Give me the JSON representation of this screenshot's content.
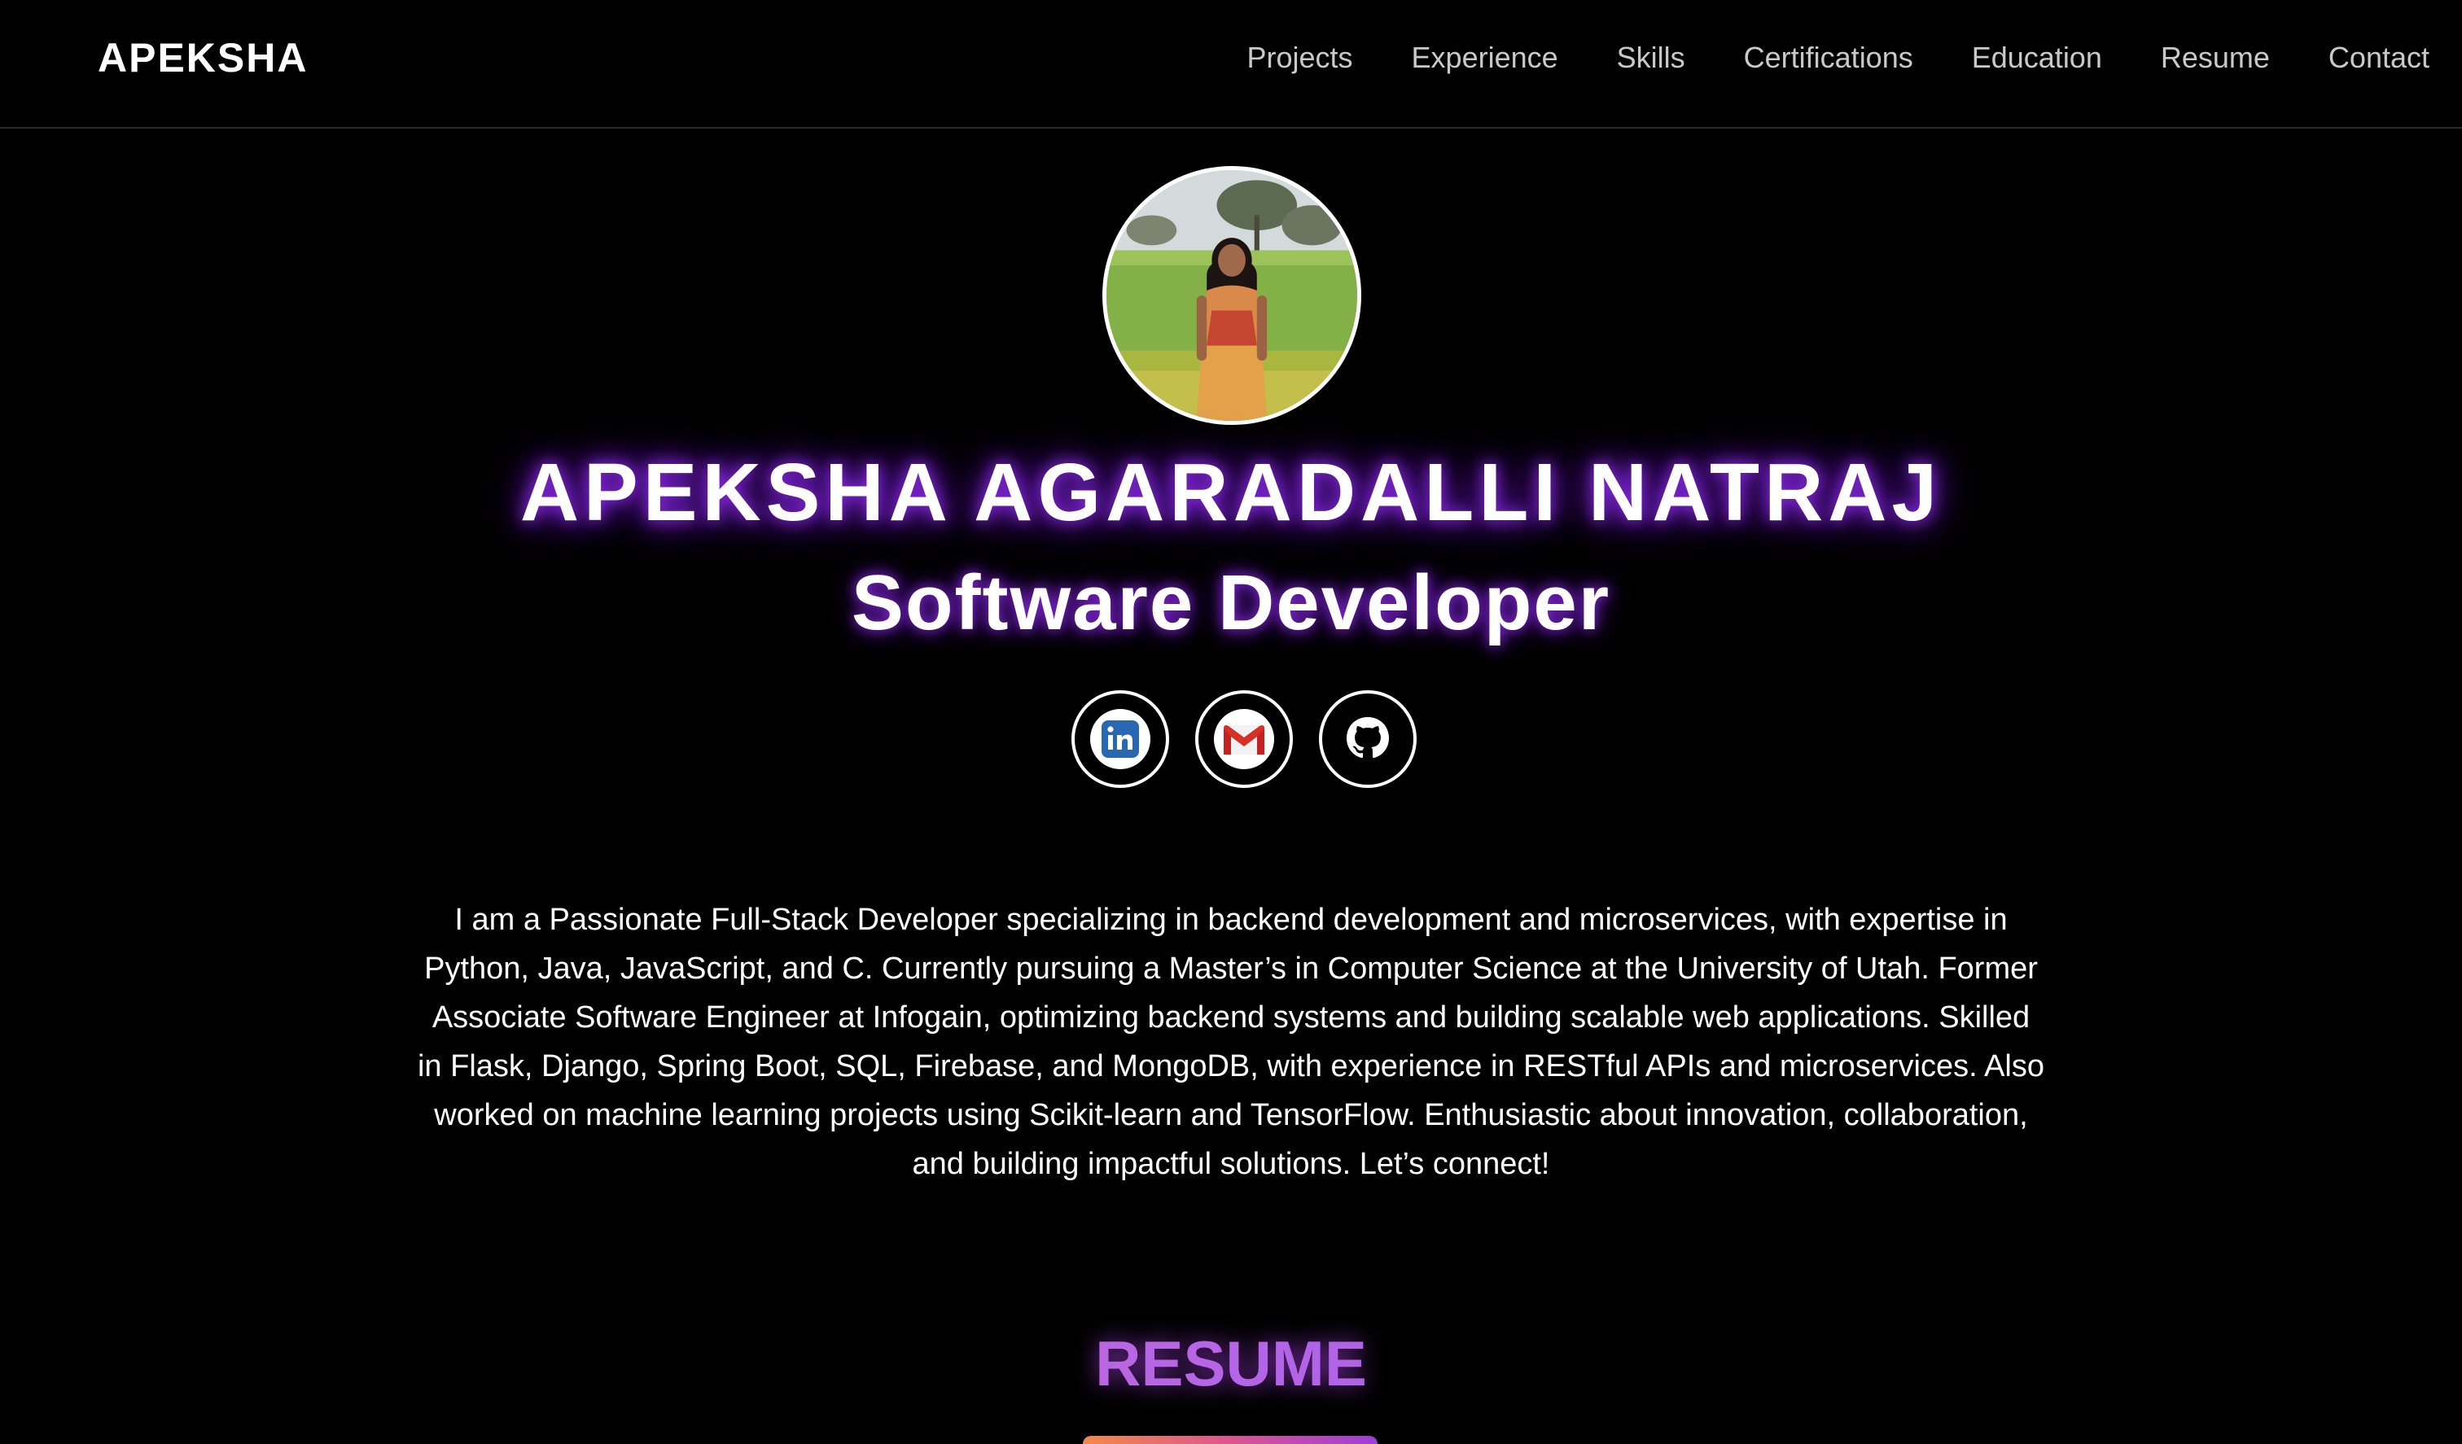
{
  "nav": {
    "brand": "APEKSHA",
    "links": [
      "Projects",
      "Experience",
      "Skills",
      "Certifications",
      "Education",
      "Resume",
      "Contact"
    ]
  },
  "hero": {
    "avatar_icon": "profile-photo",
    "name": "APEKSHA AGARADALLI NATRAJ",
    "role": "Software Developer",
    "socials": [
      {
        "icon": "linkedin-icon",
        "color": "#2867b2"
      },
      {
        "icon": "gmail-icon",
        "color": "#d93025"
      },
      {
        "icon": "github-icon",
        "color": "#ffffff"
      }
    ],
    "bio": "I am a Passionate Full-Stack Developer specializing in backend development and microservices, with expertise in Python, Java, JavaScript, and C. Currently pursuing a Master’s in Computer Science at the University of Utah. Former Associate Software Engineer at Infogain, optimizing backend systems and building scalable web applications. Skilled in Flask, Django, Spring Boot, SQL, Firebase, and MongoDB, with experience in RESTful APIs and microservices. Also worked on machine learning projects using Scikit-learn and TensorFlow. Enthusiastic about innovation, collaboration, and building impactful solutions. Let’s connect!"
  },
  "resume": {
    "heading": "RESUME"
  },
  "colors": {
    "background": "#000000",
    "glow": "#8a2be2",
    "nav_text": "#c9c9c9",
    "accent_gradient_start": "#f08a4b",
    "accent_gradient_end": "#9b3fd6"
  }
}
